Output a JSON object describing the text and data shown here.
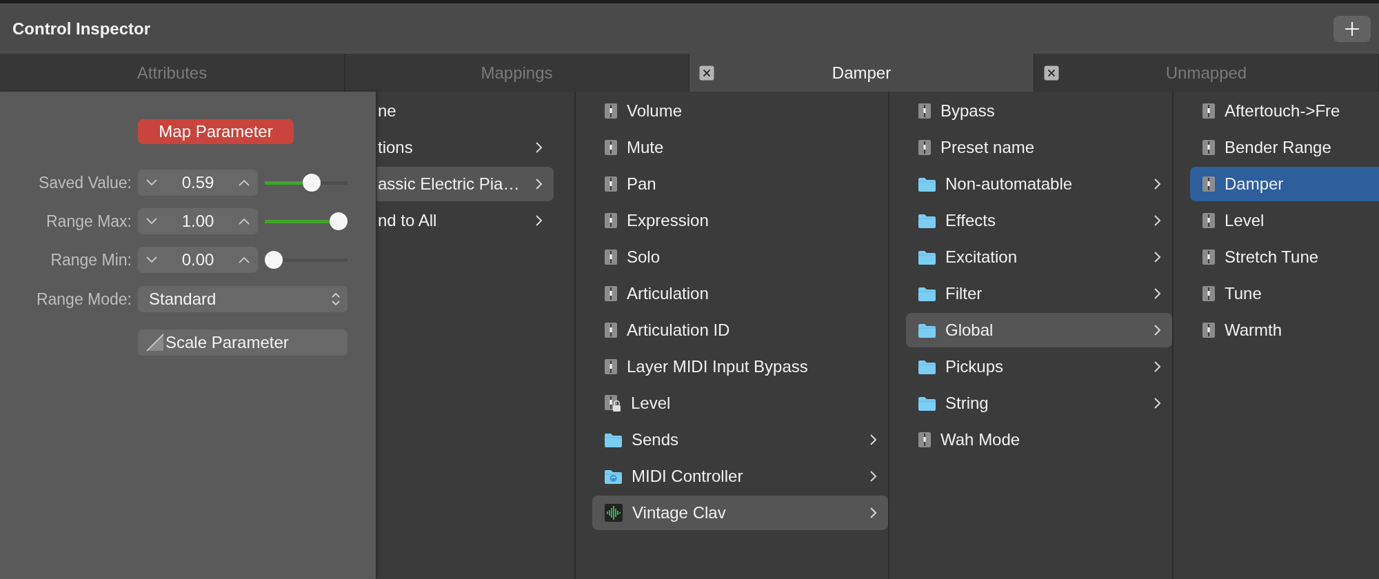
{
  "window": {
    "title": "Control Inspector"
  },
  "tabs": [
    {
      "label": "Attributes",
      "selected": false,
      "closable": false
    },
    {
      "label": "Mappings",
      "selected": false,
      "closable": false
    },
    {
      "label": "Damper",
      "selected": true,
      "closable": true
    },
    {
      "label": "Unmapped",
      "selected": false,
      "closable": true
    }
  ],
  "inspector": {
    "map_button": "Map Parameter",
    "rows": [
      {
        "kind": "stepper",
        "label": "Saved Value:",
        "value": "0.59",
        "level": 0.59
      },
      {
        "kind": "stepper",
        "label": "Range Max:",
        "value": "1.00",
        "level": 1
      },
      {
        "kind": "stepper",
        "label": "Range Min:",
        "value": "0.00",
        "level": 0
      },
      {
        "kind": "popup",
        "label": "Range Mode:",
        "value": "Standard"
      },
      {
        "kind": "button",
        "label": "Scale Parameter"
      }
    ]
  },
  "columns": [
    {
      "focused": false,
      "items": [
        {
          "kind": "plain",
          "label": "ne",
          "submenu": false,
          "selected": false
        },
        {
          "kind": "plain",
          "label": "tions",
          "submenu": true,
          "selected": false
        },
        {
          "kind": "plain",
          "label": "assic Electric Pia…",
          "submenu": true,
          "selected": true
        },
        {
          "kind": "plain",
          "label": "nd to All",
          "submenu": true,
          "selected": false
        }
      ]
    },
    {
      "focused": false,
      "items": [
        {
          "kind": "parameter",
          "label": "Volume",
          "submenu": false,
          "selected": false
        },
        {
          "kind": "parameter",
          "label": "Mute",
          "submenu": false,
          "selected": false
        },
        {
          "kind": "parameter",
          "label": "Pan",
          "submenu": false,
          "selected": false
        },
        {
          "kind": "parameter",
          "label": "Expression",
          "submenu": false,
          "selected": false
        },
        {
          "kind": "parameter",
          "label": "Solo",
          "submenu": false,
          "selected": false
        },
        {
          "kind": "parameter",
          "label": "Articulation",
          "submenu": false,
          "selected": false
        },
        {
          "kind": "parameter",
          "label": "Articulation ID",
          "submenu": false,
          "selected": false
        },
        {
          "kind": "parameter",
          "label": "Layer MIDI Input Bypass",
          "submenu": false,
          "selected": false
        },
        {
          "kind": "locked",
          "label": "Level",
          "submenu": false,
          "selected": false
        },
        {
          "kind": "folder",
          "label": "Sends",
          "submenu": true,
          "selected": false
        },
        {
          "kind": "midi",
          "label": "MIDI Controller",
          "submenu": true,
          "selected": false
        },
        {
          "kind": "instrument",
          "label": "Vintage Clav",
          "submenu": true,
          "selected": true
        }
      ]
    },
    {
      "focused": false,
      "items": [
        {
          "kind": "parameter",
          "label": "Bypass",
          "submenu": false,
          "selected": false
        },
        {
          "kind": "parameter",
          "label": "Preset name",
          "submenu": false,
          "selected": false
        },
        {
          "kind": "folder",
          "label": "Non-automatable",
          "submenu": true,
          "selected": false
        },
        {
          "kind": "folder",
          "label": "Effects",
          "submenu": true,
          "selected": false
        },
        {
          "kind": "folder",
          "label": "Excitation",
          "submenu": true,
          "selected": false
        },
        {
          "kind": "folder",
          "label": "Filter",
          "submenu": true,
          "selected": false
        },
        {
          "kind": "folder",
          "label": "Global",
          "submenu": true,
          "selected": true
        },
        {
          "kind": "folder",
          "label": "Pickups",
          "submenu": true,
          "selected": false
        },
        {
          "kind": "folder",
          "label": "String",
          "submenu": true,
          "selected": false
        },
        {
          "kind": "parameter",
          "label": "Wah Mode",
          "submenu": false,
          "selected": false
        }
      ]
    },
    {
      "focused": true,
      "items": [
        {
          "kind": "parameter",
          "label": "Aftertouch->Fre",
          "submenu": false,
          "selected": false
        },
        {
          "kind": "parameter",
          "label": "Bender Range",
          "submenu": false,
          "selected": false
        },
        {
          "kind": "parameter",
          "label": "Damper",
          "submenu": false,
          "selected": true
        },
        {
          "kind": "parameter",
          "label": "Level",
          "submenu": false,
          "selected": false
        },
        {
          "kind": "parameter",
          "label": "Stretch Tune",
          "submenu": false,
          "selected": false
        },
        {
          "kind": "parameter",
          "label": "Tune",
          "submenu": false,
          "selected": false
        },
        {
          "kind": "parameter",
          "label": "Warmth",
          "submenu": false,
          "selected": false
        }
      ]
    }
  ]
}
